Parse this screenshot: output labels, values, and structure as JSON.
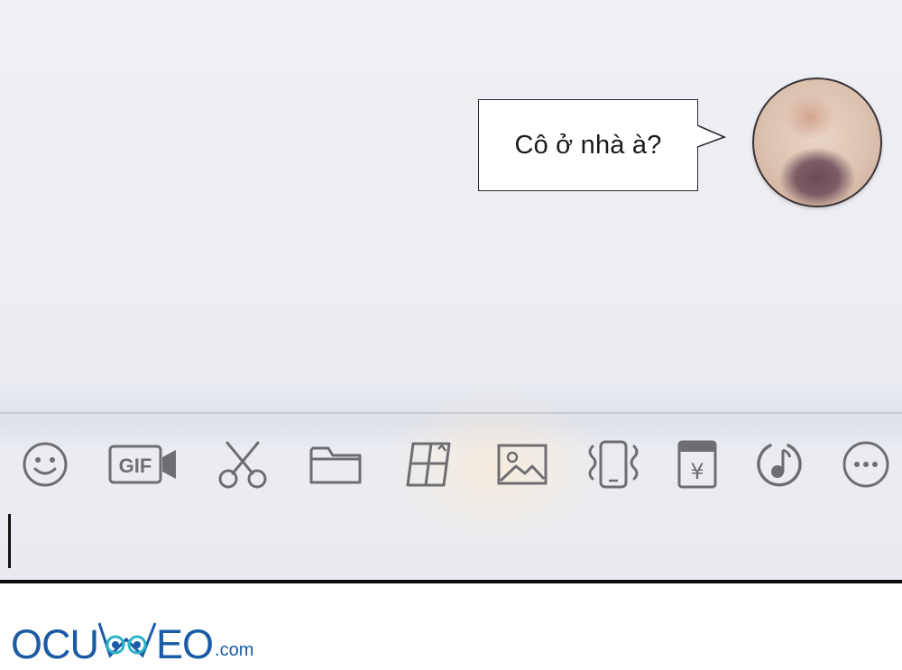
{
  "chat": {
    "message_text": "Cô ở nhà à?"
  },
  "toolbar": {
    "icons": [
      "smiley-icon",
      "gif-video-icon",
      "scissors-icon",
      "folder-icon",
      "sticker-icon",
      "image-icon",
      "vibrate-phone-icon",
      "red-packet-icon",
      "music-icon",
      "more-icon"
    ],
    "gif_label": "GIF",
    "red_packet_symbol": "¥"
  },
  "footer": {
    "logo_part1": "OCU",
    "logo_part2": "EO",
    "logo_suffix": ".com"
  },
  "colors": {
    "chat_background": "#eceef3",
    "icon_gray": "#6e6e72",
    "logo_blue": "#1a5ba6",
    "logo_accent": "#2bb3c9"
  }
}
